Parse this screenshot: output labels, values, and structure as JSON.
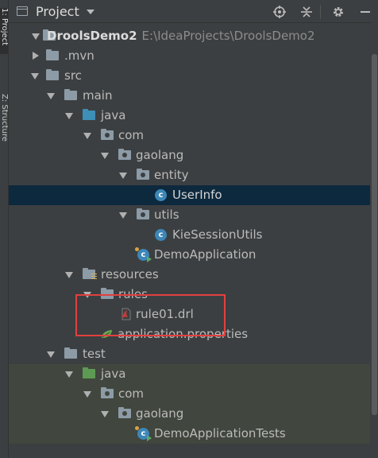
{
  "side_tabs": [
    {
      "label": "1: Project",
      "active": true
    },
    {
      "label": "Z: Structure",
      "active": false
    }
  ],
  "header": {
    "title": "Project",
    "buttons": [
      "locate-icon",
      "collapse-icon",
      "settings-icon",
      "minimize-icon"
    ]
  },
  "tree": [
    {
      "label": "DroolsDemo2",
      "path": "E:\\IdeaProjects\\DroolsDemo2",
      "icon": "project-folder-icon",
      "expanded": true
    },
    {
      "label": ".mvn",
      "icon": "folder-icon",
      "expanded": false
    },
    {
      "label": "src",
      "icon": "folder-icon",
      "expanded": true
    },
    {
      "label": "main",
      "icon": "folder-icon",
      "expanded": true
    },
    {
      "label": "java",
      "icon": "source-folder-icon",
      "expanded": true
    },
    {
      "label": "com",
      "icon": "package-icon",
      "expanded": true
    },
    {
      "label": "gaolang",
      "icon": "package-icon",
      "expanded": true
    },
    {
      "label": "entity",
      "icon": "package-icon",
      "expanded": true
    },
    {
      "label": "UserInfo",
      "icon": "class-icon",
      "selected": true
    },
    {
      "label": "utils",
      "icon": "package-icon",
      "expanded": true
    },
    {
      "label": "KieSessionUtils",
      "icon": "class-icon"
    },
    {
      "label": "DemoApplication",
      "icon": "spring-boot-class-icon"
    },
    {
      "label": "resources",
      "icon": "resources-folder-icon",
      "expanded": true
    },
    {
      "label": "rules",
      "icon": "folder-icon",
      "expanded": true
    },
    {
      "label": "rule01.drl",
      "icon": "drools-file-icon"
    },
    {
      "label": "application.properties",
      "icon": "spring-properties-icon"
    },
    {
      "label": "test",
      "icon": "folder-icon",
      "expanded": true
    },
    {
      "label": "java",
      "icon": "test-source-folder-icon",
      "expanded": true
    },
    {
      "label": "com",
      "icon": "package-icon",
      "expanded": true
    },
    {
      "label": "gaolang",
      "icon": "package-icon",
      "expanded": true
    },
    {
      "label": "DemoApplicationTests",
      "icon": "spring-boot-test-class-icon"
    }
  ],
  "colors": {
    "background": "#3c3f41",
    "selection": "#0d293e",
    "test_background": "#41463e",
    "highlight_box": "#e04040"
  }
}
